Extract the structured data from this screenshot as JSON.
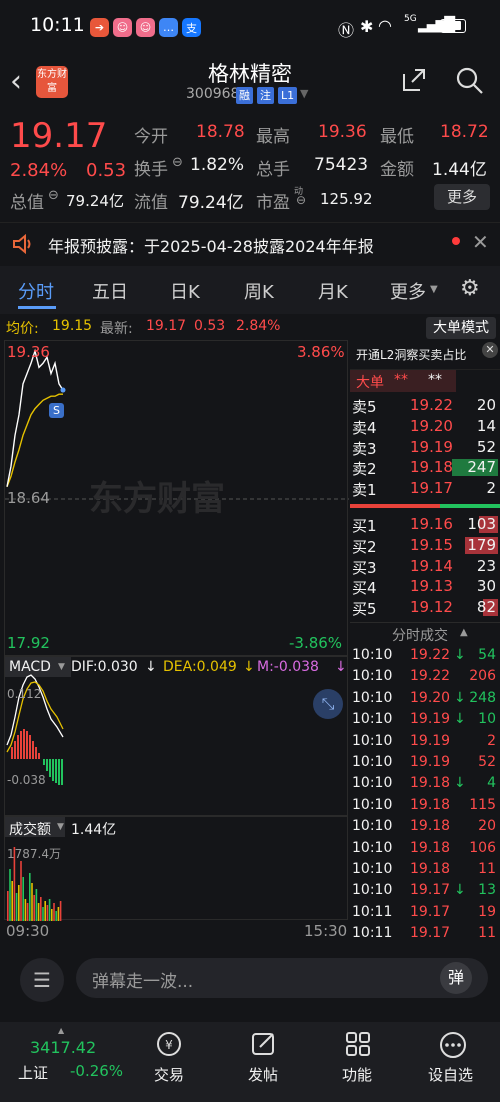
{
  "status_bar": {
    "time": "10:11",
    "network": "5G"
  },
  "header": {
    "back_label": "<",
    "logo_text": "东方财富",
    "title": "格林精密",
    "code": "300968",
    "tags": [
      "融",
      "注",
      "L1"
    ]
  },
  "quote": {
    "price": "19.17",
    "change_pct": "2.84%",
    "change": "0.53",
    "open_label": "今开",
    "open": "18.78",
    "high_label": "最高",
    "high": "19.36",
    "low_label": "最低",
    "low": "18.72",
    "turnover_label": "换手",
    "turnover": "1.82%",
    "volume_label": "总手",
    "volume": "75423",
    "amount_label": "金额",
    "amount": "1.44亿",
    "mktcap_label": "总值",
    "mktcap": "79.24亿",
    "float_label": "流值",
    "float": "79.24亿",
    "pe_label": "市盈",
    "pe_mark": "动",
    "pe": "125.92",
    "more_label": "更多"
  },
  "notice": {
    "text": "年报预披露：于2025-04-28披露2024年年报"
  },
  "tabs": [
    "分时",
    "五日",
    "日K",
    "周K",
    "月K",
    "更多",
    "⚙"
  ],
  "chart": {
    "avg_label": "均价:",
    "avg": "19.15",
    "latest_label": "最新:",
    "latest": "19.17",
    "latest_chg": "0.53",
    "latest_pct": "2.84%",
    "bigorder_btn": "大单模式",
    "price_top": "19.36",
    "pct_top": "3.86%",
    "price_mid": "18.64",
    "price_bottom": "17.92",
    "pct_bottom": "-3.86%",
    "watermark": "东方财富",
    "s_badge": "S",
    "time_start": "09:30",
    "time_end": "15:30"
  },
  "chart_data": {
    "type": "line",
    "price_series": [
      18.7,
      18.8,
      18.95,
      19.05,
      19.2,
      19.25,
      19.3,
      19.36,
      19.28,
      19.3,
      19.33,
      19.25,
      19.3,
      19.2,
      19.17
    ],
    "avg_series": [
      18.7,
      18.75,
      18.82,
      18.88,
      18.95,
      19.0,
      19.05,
      19.08,
      19.1,
      19.12,
      19.13,
      19.14,
      19.14,
      19.15,
      19.15
    ],
    "ylim": [
      17.92,
      19.36
    ]
  },
  "macd": {
    "label": "MACD",
    "dif_label": "DIF:0.030",
    "dea_label": "DEA:0.049",
    "m_label": "M:-0.038",
    "top": "0.112",
    "bottom": "-0.038"
  },
  "volume": {
    "label": "成交额",
    "value": "1.44亿",
    "top": "1787.4万"
  },
  "orderbook": {
    "l2_label": "开通L2洞察买卖占比",
    "big_label": "大单",
    "big_stars": "**",
    "big_stars2": "**",
    "sell": [
      [
        "卖5",
        "19.22",
        "20"
      ],
      [
        "卖4",
        "19.20",
        "14"
      ],
      [
        "卖3",
        "19.19",
        "52"
      ],
      [
        "卖2",
        "19.18",
        "247"
      ],
      [
        "卖1",
        "19.17",
        "2"
      ]
    ],
    "buy": [
      [
        "买1",
        "19.16",
        "103"
      ],
      [
        "买2",
        "19.15",
        "179"
      ],
      [
        "买3",
        "19.14",
        "23"
      ],
      [
        "买4",
        "19.13",
        "30"
      ],
      [
        "买5",
        "19.12",
        "82"
      ]
    ]
  },
  "trades": {
    "title": "分时成交",
    "rows": [
      [
        "10:10",
        "19.22",
        "↓",
        "54"
      ],
      [
        "10:10",
        "19.22",
        "",
        "206"
      ],
      [
        "10:10",
        "19.20",
        "↓",
        "248"
      ],
      [
        "10:10",
        "19.19",
        "↓",
        "10"
      ],
      [
        "10:10",
        "19.19",
        "",
        "2"
      ],
      [
        "10:10",
        "19.19",
        "",
        "52"
      ],
      [
        "10:10",
        "19.18",
        "↓",
        "4"
      ],
      [
        "10:10",
        "19.18",
        "",
        "115"
      ],
      [
        "10:10",
        "19.18",
        "",
        "20"
      ],
      [
        "10:10",
        "19.18",
        "",
        "106"
      ],
      [
        "10:10",
        "19.18",
        "",
        "11"
      ],
      [
        "10:10",
        "19.17",
        "↓",
        "13"
      ],
      [
        "10:11",
        "19.17",
        "",
        "19"
      ],
      [
        "10:11",
        "19.17",
        "",
        "11"
      ]
    ]
  },
  "comment": {
    "placeholder": "弹幕走一波...",
    "danmu": "弹"
  },
  "bottom_nav": {
    "index_value": "3417.42",
    "index_name": "上证",
    "index_pct": "-0.26%",
    "items": [
      "交易",
      "发帖",
      "功能",
      "设自选"
    ]
  }
}
